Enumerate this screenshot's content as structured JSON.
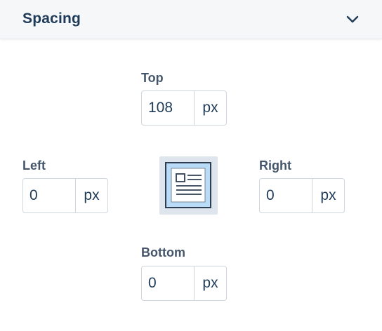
{
  "header": {
    "title": "Spacing"
  },
  "spacing": {
    "top": {
      "label": "Top",
      "value": "108",
      "unit": "px"
    },
    "left": {
      "label": "Left",
      "value": "0",
      "unit": "px"
    },
    "right": {
      "label": "Right",
      "value": "0",
      "unit": "px"
    },
    "bottom": {
      "label": "Bottom",
      "value": "0",
      "unit": "px"
    }
  },
  "icons": {
    "collapse": "chevron-down-icon",
    "preview": "layout-preview-icon"
  }
}
